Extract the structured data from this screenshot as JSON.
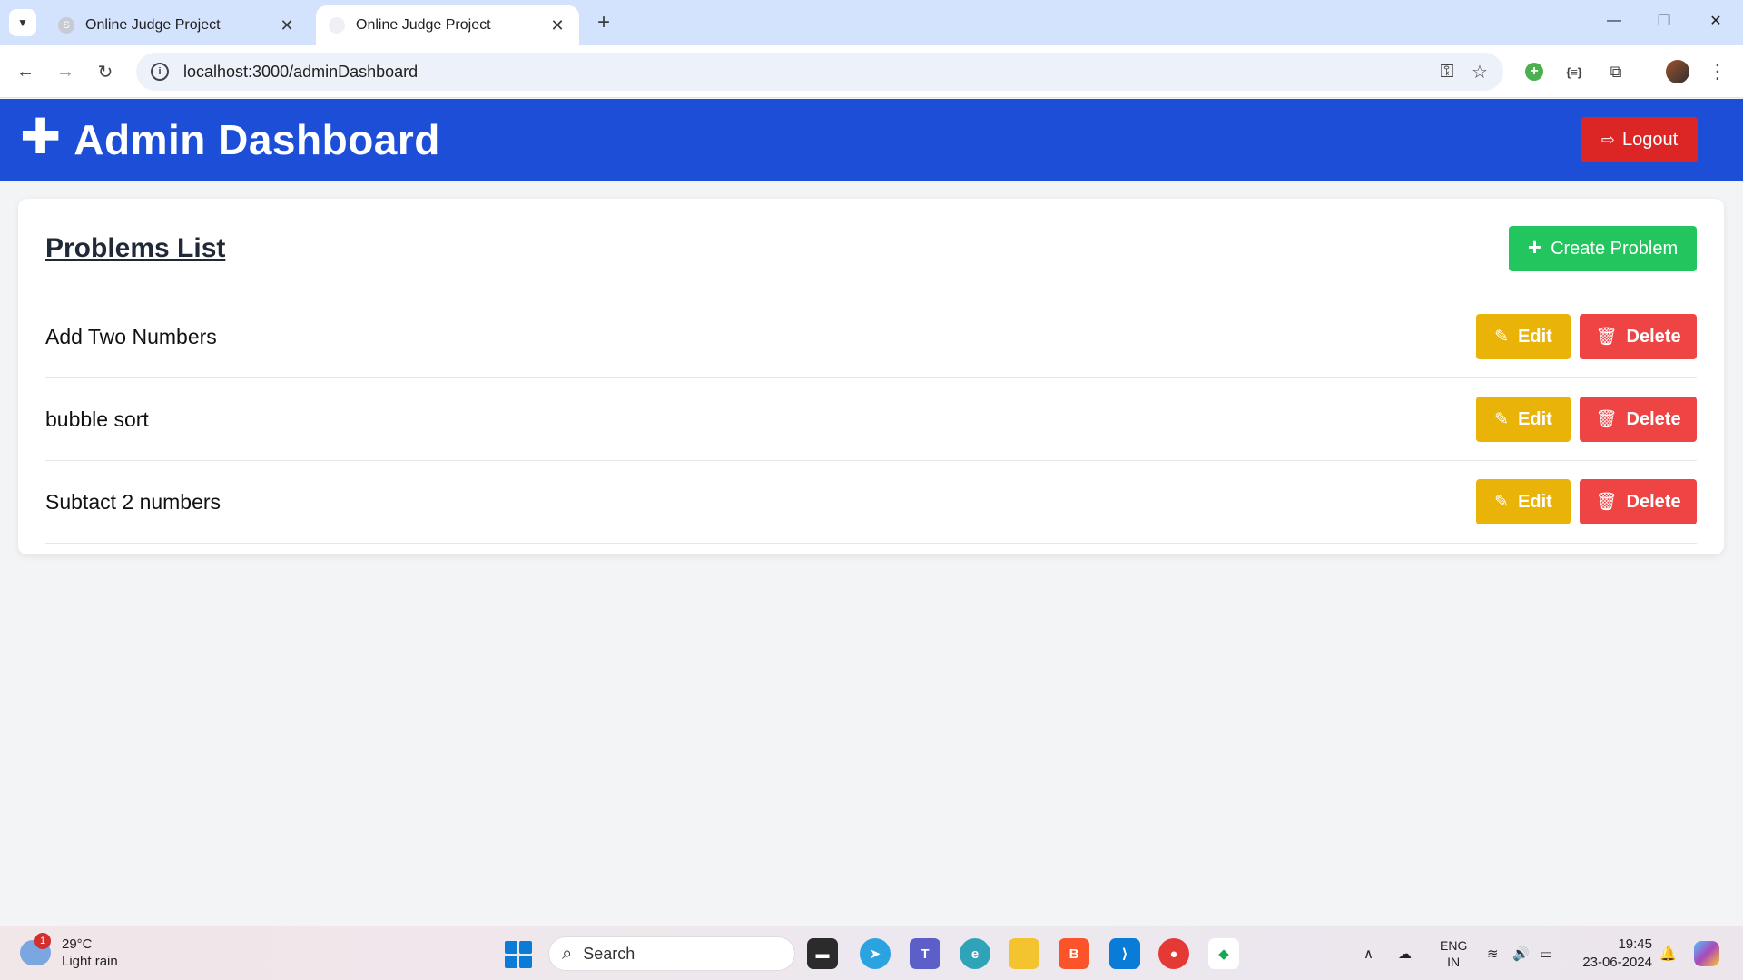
{
  "browser": {
    "tabs": [
      {
        "title": "Online Judge Project",
        "active": false
      },
      {
        "title": "Online Judge Project",
        "active": true
      }
    ],
    "url": "localhost:3000/adminDashboard"
  },
  "header": {
    "title": "Admin Dashboard",
    "logout_label": "Logout"
  },
  "problems": {
    "title": "Problems List",
    "create_label": "Create Problem",
    "edit_label": "Edit",
    "delete_label": "Delete",
    "items": [
      {
        "name": "Add Two Numbers"
      },
      {
        "name": "bubble sort"
      },
      {
        "name": "Subtact 2 numbers"
      }
    ]
  },
  "taskbar": {
    "weather_badge": "1",
    "temperature": "29°C",
    "condition": "Light rain",
    "search_placeholder": "Search",
    "language_line1": "ENG",
    "language_line2": "IN",
    "time": "19:45",
    "date": "23-06-2024"
  },
  "colors": {
    "header_bg": "#1d4ed8",
    "logout": "#dc2626",
    "create": "#22c55e",
    "edit": "#eab308",
    "delete": "#ef4444"
  }
}
